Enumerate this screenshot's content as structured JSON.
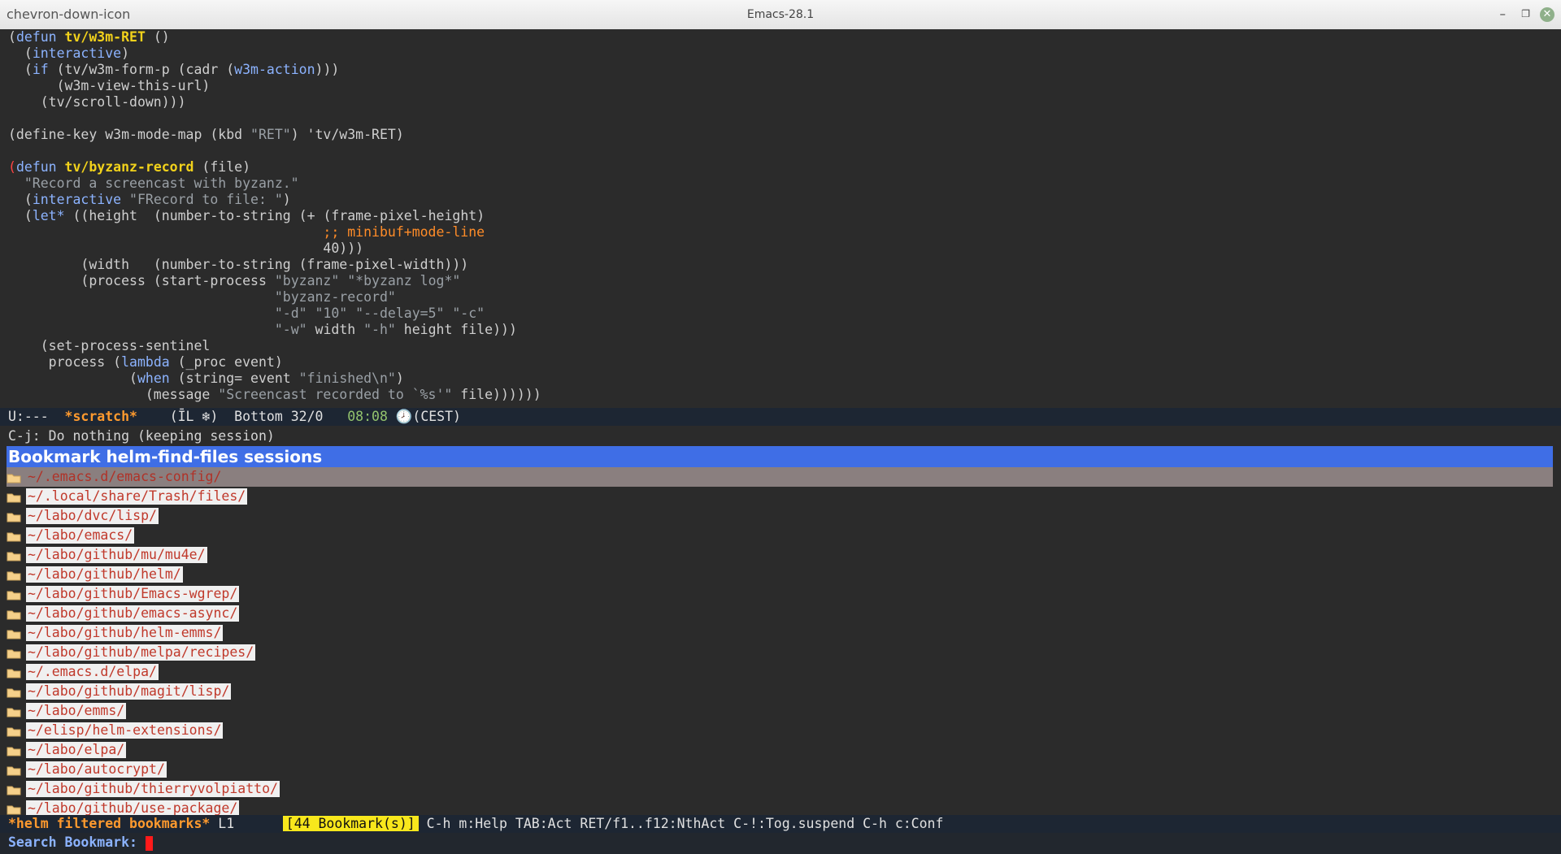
{
  "window": {
    "title": "Emacs-28.1",
    "menu_icon": "chevron-down-icon",
    "minimize": "–",
    "restore": "❐",
    "close": "✕"
  },
  "code_lines": [
    [
      {
        "t": "(",
        "c": "df"
      },
      {
        "t": "defun",
        "c": "kw"
      },
      {
        "t": " ",
        "c": "df"
      },
      {
        "t": "tv/w3m-RET",
        "c": "fn"
      },
      {
        "t": " ()",
        "c": "df"
      }
    ],
    [
      {
        "t": "  (",
        "c": "df"
      },
      {
        "t": "interactive",
        "c": "kw"
      },
      {
        "t": ")",
        "c": "df"
      }
    ],
    [
      {
        "t": "  (",
        "c": "df"
      },
      {
        "t": "if",
        "c": "kw"
      },
      {
        "t": " (tv/w3m-form-p (cadr (",
        "c": "df"
      },
      {
        "t": "w3m-action",
        "c": "kw"
      },
      {
        "t": ")))",
        "c": "df"
      }
    ],
    [
      {
        "t": "      (w3m-view-this-url)",
        "c": "df"
      }
    ],
    [
      {
        "t": "    (tv/scroll-down)))",
        "c": "df"
      }
    ],
    [
      {
        "t": "",
        "c": "df"
      }
    ],
    [
      {
        "t": "(define-key w3m-mode-map (kbd ",
        "c": "df"
      },
      {
        "t": "\"RET\"",
        "c": "st"
      },
      {
        "t": ") 'tv/w3m-RET)",
        "c": "df"
      }
    ],
    [
      {
        "t": "",
        "c": "df"
      }
    ],
    [
      {
        "t": "(",
        "c": "paren"
      },
      {
        "t": "defun",
        "c": "kw"
      },
      {
        "t": " ",
        "c": "df"
      },
      {
        "t": "tv/byzanz-record",
        "c": "fn"
      },
      {
        "t": " (file)",
        "c": "df"
      }
    ],
    [
      {
        "t": "  \"Record a screencast with byzanz.\"",
        "c": "st"
      }
    ],
    [
      {
        "t": "  (",
        "c": "df"
      },
      {
        "t": "interactive",
        "c": "kw"
      },
      {
        "t": " ",
        "c": "df"
      },
      {
        "t": "\"FRecord to file: \"",
        "c": "st"
      },
      {
        "t": ")",
        "c": "df"
      }
    ],
    [
      {
        "t": "  (",
        "c": "df"
      },
      {
        "t": "let*",
        "c": "kw"
      },
      {
        "t": " ((height  (number-to-string (+ (frame-pixel-height)",
        "c": "df"
      }
    ],
    [
      {
        "t": "                                       ",
        "c": "df"
      },
      {
        "t": ";; minibuf+mode-line",
        "c": "cm"
      }
    ],
    [
      {
        "t": "                                       40)))",
        "c": "df"
      }
    ],
    [
      {
        "t": "         (width   (number-to-string (frame-pixel-width)))",
        "c": "df"
      }
    ],
    [
      {
        "t": "         (process (start-process ",
        "c": "df"
      },
      {
        "t": "\"byzanz\"",
        "c": "st"
      },
      {
        "t": " ",
        "c": "df"
      },
      {
        "t": "\"*byzanz log*\"",
        "c": "st"
      }
    ],
    [
      {
        "t": "                                 ",
        "c": "df"
      },
      {
        "t": "\"byzanz-record\"",
        "c": "st"
      }
    ],
    [
      {
        "t": "                                 ",
        "c": "df"
      },
      {
        "t": "\"-d\" \"10\" \"--delay=5\" \"-c\"",
        "c": "st"
      }
    ],
    [
      {
        "t": "                                 ",
        "c": "df"
      },
      {
        "t": "\"-w\"",
        "c": "st"
      },
      {
        "t": " width ",
        "c": "df"
      },
      {
        "t": "\"-h\"",
        "c": "st"
      },
      {
        "t": " height file)))",
        "c": "df"
      }
    ],
    [
      {
        "t": "    (set-process-sentinel",
        "c": "df"
      }
    ],
    [
      {
        "t": "     process (",
        "c": "df"
      },
      {
        "t": "lambda",
        "c": "kw"
      },
      {
        "t": " (_proc event)",
        "c": "df"
      }
    ],
    [
      {
        "t": "               (",
        "c": "df"
      },
      {
        "t": "when",
        "c": "kw"
      },
      {
        "t": " (string= event ",
        "c": "df"
      },
      {
        "t": "\"finished\\n\"",
        "c": "st"
      },
      {
        "t": ")",
        "c": "df"
      }
    ],
    [
      {
        "t": "                 (message ",
        "c": "df"
      },
      {
        "t": "\"Screencast recorded to `%s'\"",
        "c": "st"
      },
      {
        "t": " file))))))",
        "c": "df"
      }
    ]
  ],
  "modeline": {
    "status": "U:---  ",
    "buffer": "*scratch*",
    "modes": "    (ĪL ❄)  Bottom 32/0   ",
    "time": "08:08",
    "tz": " 🕗(CEST)"
  },
  "echo": "C-j: Do nothing (keeping session)",
  "helm": {
    "header": "Bookmark helm-find-files sessions",
    "items": [
      "~/.emacs.d/emacs-config/",
      "~/.local/share/Trash/files/",
      "~/labo/dvc/lisp/",
      "~/labo/emacs/",
      "~/labo/github/mu/mu4e/",
      "~/labo/github/helm/",
      "~/labo/github/Emacs-wgrep/",
      "~/labo/github/emacs-async/",
      "~/labo/github/helm-emms/",
      "~/labo/github/melpa/recipes/",
      "~/.emacs.d/elpa/",
      "~/labo/github/magit/lisp/",
      "~/labo/emms/",
      "~/elisp/helm-extensions/",
      "~/labo/elpa/",
      "~/labo/autocrypt/",
      "~/labo/github/thierryvolpiatto/",
      "~/labo/github/use-package/"
    ],
    "modeline_name": "*helm filtered bookmarks*",
    "modeline_line": " L1      ",
    "modeline_count": "[44 Bookmark(s)]",
    "modeline_help": " C-h m:Help TAB:Act RET/f1..f12:NthAct C-!:Tog.suspend C-h c:Conf"
  },
  "minibuffer": {
    "prompt": "Search Bookmark: "
  },
  "colors": {
    "folder": "#f5d08a",
    "header": "#3f6ee6",
    "selected": "#8a7f7f"
  }
}
